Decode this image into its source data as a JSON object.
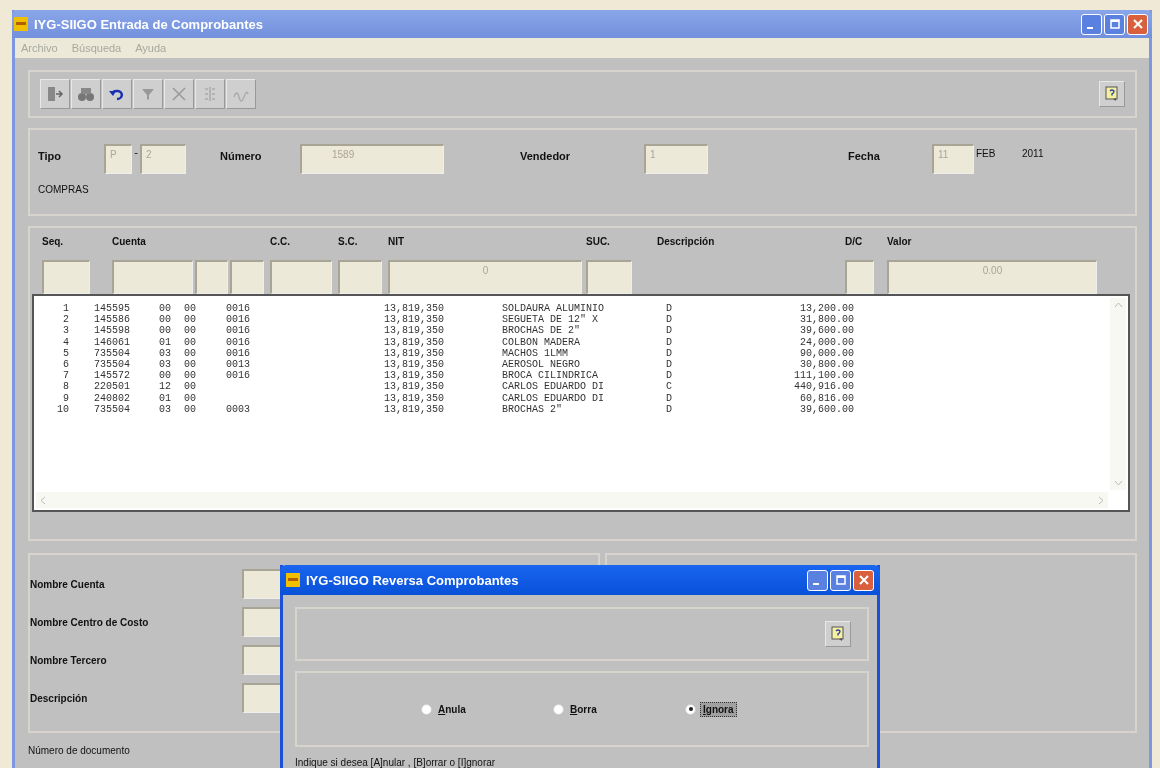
{
  "window": {
    "title": "IYG-SIIGO Entrada de Comprobantes"
  },
  "menu": [
    {
      "label": "Archivo",
      "disabled": true
    },
    {
      "label": "Búsqueda",
      "disabled": true
    },
    {
      "label": "Ayuda",
      "disabled": true
    }
  ],
  "header": {
    "tipo_label": "Tipo",
    "tipo_letter": "P",
    "tipo_separator": "-",
    "tipo_number": "2",
    "tipo_name": "COMPRAS",
    "numero_label": "Número",
    "numero": "1589",
    "vendedor_label": "Vendedor",
    "vendedor": "1",
    "fecha_label": "Fecha",
    "fecha_day": "11",
    "fecha_month": "FEB",
    "fecha_year": "2011"
  },
  "grid": {
    "field_labels": [
      "Seq.",
      "Cuenta",
      "C.C.",
      "S.C.",
      "NIT",
      "SUC.",
      "Descripción",
      "D/C",
      "Valor"
    ],
    "inputs": {
      "nit": "0",
      "valor": "0.00"
    },
    "entries": [
      {
        "seq": "1",
        "cuenta": "145595",
        "sub_1": "00",
        "sub_2": "00",
        "code": "0016",
        "nit": "13,819,350",
        "descripcion": "SOLDAURA ALUMINIO",
        "dc": "D",
        "valor": "13,200.00"
      },
      {
        "seq": "2",
        "cuenta": "145586",
        "sub_1": "00",
        "sub_2": "00",
        "code": "0016",
        "nit": "13,819,350",
        "descripcion": "SEGUETA DE 12\" X",
        "dc": "D",
        "valor": "31,800.00"
      },
      {
        "seq": "3",
        "cuenta": "145598",
        "sub_1": "00",
        "sub_2": "00",
        "code": "0016",
        "nit": "13,819,350",
        "descripcion": "BROCHAS DE 2\"",
        "dc": "D",
        "valor": "39,600.00"
      },
      {
        "seq": "4",
        "cuenta": "146061",
        "sub_1": "01",
        "sub_2": "00",
        "code": "0016",
        "nit": "13,819,350",
        "descripcion": "COLBON MADERA",
        "dc": "D",
        "valor": "24,000.00"
      },
      {
        "seq": "5",
        "cuenta": "735504",
        "sub_1": "03",
        "sub_2": "00",
        "code": "0016",
        "nit": "13,819,350",
        "descripcion": "MACHOS 1LMM",
        "dc": "D",
        "valor": "90,000.00"
      },
      {
        "seq": "6",
        "cuenta": "735504",
        "sub_1": "03",
        "sub_2": "00",
        "code": "0013",
        "nit": "13,819,350",
        "descripcion": "AEROSOL NEGRO",
        "dc": "D",
        "valor": "30,800.00"
      },
      {
        "seq": "7",
        "cuenta": "145572",
        "sub_1": "00",
        "sub_2": "00",
        "code": "0016",
        "nit": "13,819,350",
        "descripcion": "BROCA CILINDRICA",
        "dc": "D",
        "valor": "111,100.00"
      },
      {
        "seq": "8",
        "cuenta": "220501",
        "sub_1": "12",
        "sub_2": "00",
        "nit": "13,819,350",
        "descripcion": "CARLOS EDUARDO DI",
        "dc": "C",
        "valor": "440,916.00"
      },
      {
        "seq": "9",
        "cuenta": "240802",
        "sub_1": "01",
        "sub_2": "00",
        "nit": "13,819,350",
        "descripcion": "CARLOS EDUARDO DI",
        "dc": "D",
        "valor": "60,816.00"
      },
      {
        "seq": "10",
        "cuenta": "735504",
        "sub_1": "03",
        "sub_2": "00",
        "code": "0003",
        "nit": "13,819,350",
        "descripcion": "BROCHAS 2\"",
        "dc": "D",
        "valor": "39,600.00"
      }
    ]
  },
  "details": [
    "Nombre Cuenta",
    "Nombre Centro de Costo",
    "Nombre Tercero",
    "Descripción"
  ],
  "status_bar": "Número de documento",
  "dialog": {
    "title": "IYG-SIIGO Reversa Comprobantes",
    "options": [
      {
        "label": "Anula",
        "selected": false
      },
      {
        "label": "Borra",
        "selected": false
      },
      {
        "label": "Ignora",
        "selected": true
      }
    ],
    "hint": "Indique si desea [A]nular , [B]orrar o [I]gnorar"
  }
}
